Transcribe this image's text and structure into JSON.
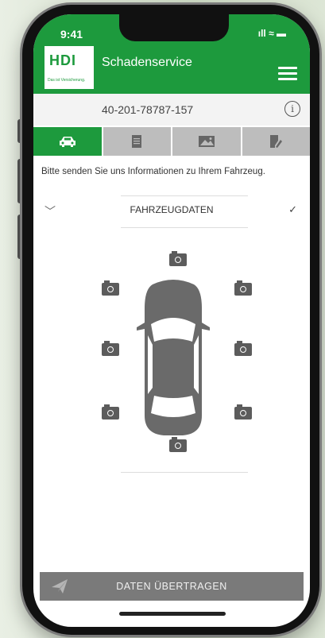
{
  "status": {
    "time": "9:41",
    "icons": "ıll ≈ ▬"
  },
  "header": {
    "logo": "HDI",
    "logo_tagline": "Das ist Versicherung.",
    "title": "Schadenservice"
  },
  "claim": {
    "number": "40-201-78787-157"
  },
  "tabs": [
    {
      "name": "vehicle",
      "icon": "car-icon",
      "active": true
    },
    {
      "name": "documents",
      "icon": "document-icon",
      "active": false
    },
    {
      "name": "images",
      "icon": "image-icon",
      "active": false
    },
    {
      "name": "notes",
      "icon": "edit-note-icon",
      "active": false
    }
  ],
  "main": {
    "instruction": "Bitte senden Sie uns Informationen zu Ihrem Fahrzeug.",
    "section_title": "FAHRZEUGDATEN"
  },
  "footer": {
    "send_label": "DATEN ÜBERTRAGEN"
  },
  "colors": {
    "brand": "#1d9a3d",
    "tab_inactive": "#bdbdbd",
    "send_bar": "#7a7a7a",
    "car": "#6a6a6a"
  }
}
